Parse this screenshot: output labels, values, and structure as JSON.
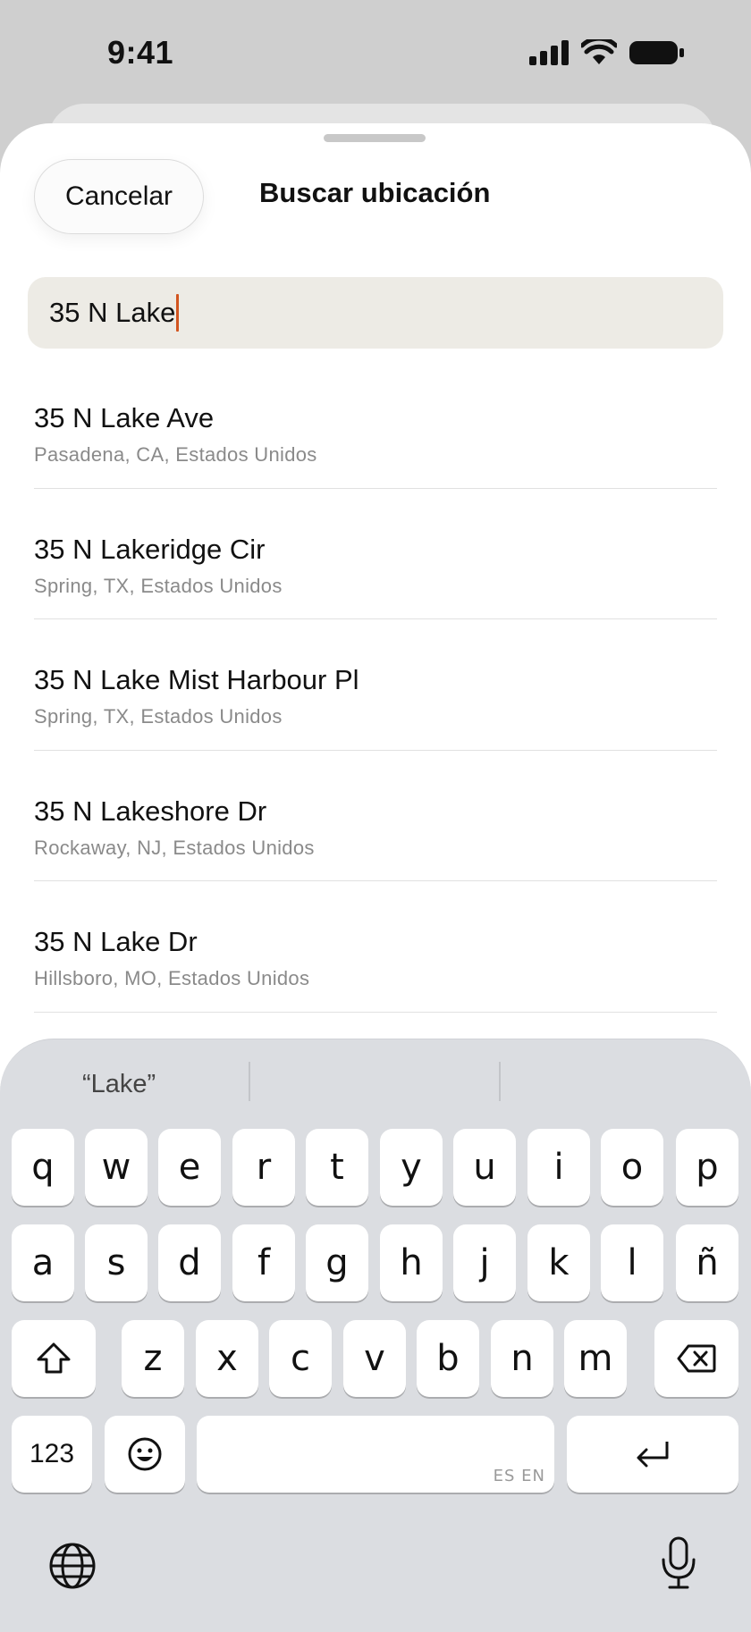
{
  "status_bar": {
    "time": "9:41",
    "icons": [
      "cellular-signal-icon",
      "wifi-icon",
      "battery-icon"
    ]
  },
  "sheet": {
    "cancel_label": "Cancelar",
    "title": "Buscar ubicación"
  },
  "search": {
    "value": "35 N Lake",
    "caret_color": "#d2551f"
  },
  "results": [
    {
      "title": "35 N Lake Ave",
      "subtitle": "Pasadena, CA, Estados Unidos"
    },
    {
      "title": "35 N Lakeridge Cir",
      "subtitle": "Spring, TX, Estados Unidos"
    },
    {
      "title": "35 N Lake Mist Harbour Pl",
      "subtitle": "Spring, TX, Estados Unidos"
    },
    {
      "title": "35 N Lakeshore Dr",
      "subtitle": "Rockaway, NJ, Estados Unidos"
    },
    {
      "title": "35 N Lake Dr",
      "subtitle": "Hillsboro, MO, Estados Unidos"
    }
  ],
  "keyboard": {
    "suggestion": "“Lake”",
    "rows": [
      [
        "q",
        "w",
        "e",
        "r",
        "t",
        "y",
        "u",
        "i",
        "o",
        "p"
      ],
      [
        "a",
        "s",
        "d",
        "f",
        "g",
        "h",
        "j",
        "k",
        "l",
        "ñ"
      ],
      [
        "z",
        "x",
        "c",
        "v",
        "b",
        "n",
        "m"
      ]
    ],
    "numbers_label": "123",
    "language_hint": "ES EN",
    "icons": [
      "shift-icon",
      "delete-icon",
      "emoji-icon",
      "return-icon",
      "globe-icon",
      "microphone-icon"
    ]
  }
}
